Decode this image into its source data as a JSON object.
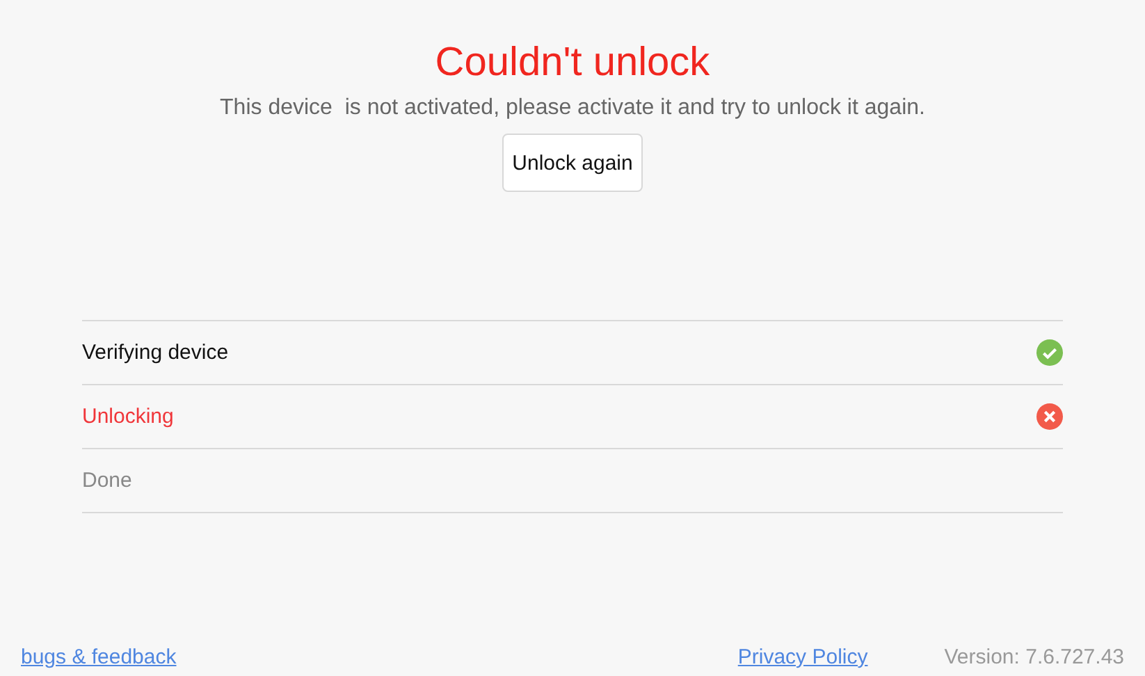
{
  "title": "Couldn't unlock",
  "message": "This device  is not activated, please activate it and try to unlock it again.",
  "button": "Unlock again",
  "steps": [
    {
      "label": "Verifying device",
      "kind": "done"
    },
    {
      "label": "Unlocking",
      "kind": "failed"
    },
    {
      "label": "Done",
      "kind": "pending"
    }
  ],
  "footer": {
    "feedback_link": "bugs & feedback",
    "privacy_link": "Privacy Policy",
    "version": "Version: 7.6.727.43"
  }
}
